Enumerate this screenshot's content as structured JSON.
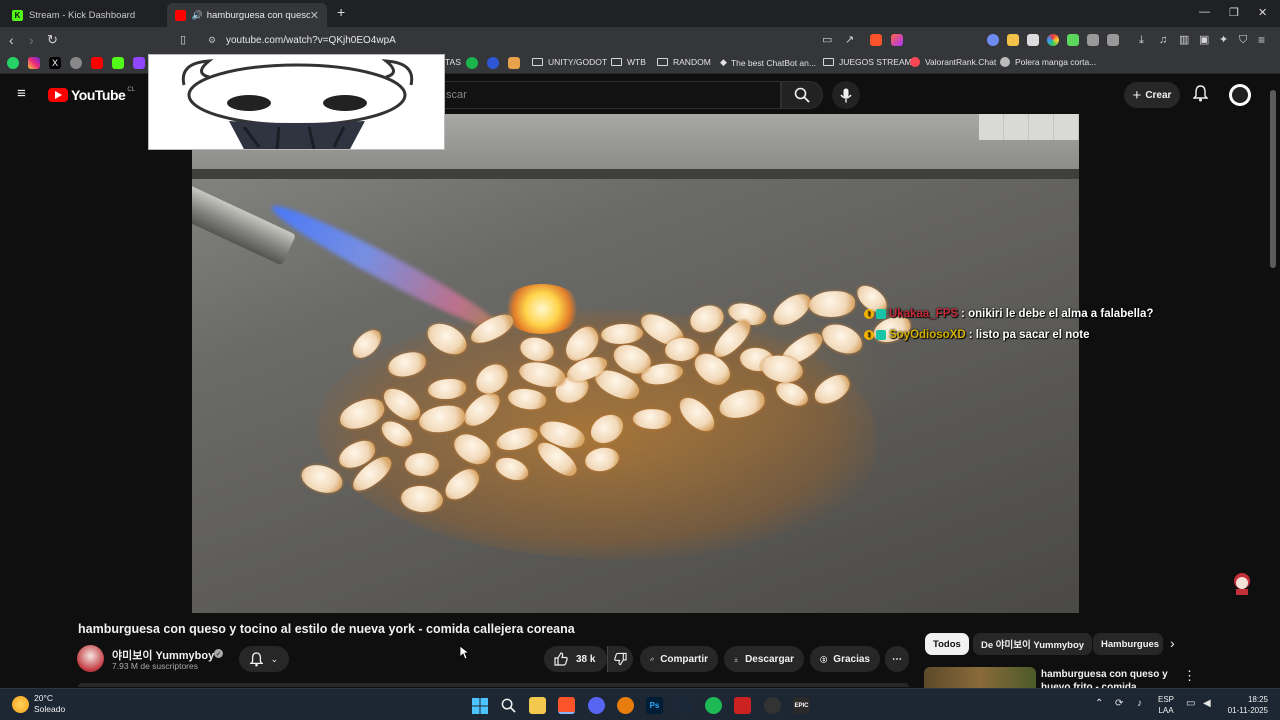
{
  "browser": {
    "tabs": [
      {
        "title": "Stream - Kick Dashboard",
        "active": false
      },
      {
        "title": "hamburguesa con queso y tc",
        "active": true
      }
    ],
    "new_tab": "+",
    "url": "youtube.com/watch?v=QKjh0EO4wpA",
    "window_controls": {
      "minimize": "—",
      "maximize": "❐",
      "close": "✕"
    }
  },
  "bookmarks": {
    "items": [
      {
        "label": "TAS",
        "icon": "bookmark-icon"
      },
      {
        "label": "UNITY/GODOT",
        "icon": "folder-icon"
      },
      {
        "label": "WTB",
        "icon": "folder-icon"
      },
      {
        "label": "RANDOM",
        "icon": "folder-icon"
      },
      {
        "label": "The best ChatBot an...",
        "icon": "diamond-icon"
      },
      {
        "label": "JUEGOS STREAM",
        "icon": "folder-icon"
      },
      {
        "label": "ValorantRank.Chat",
        "icon": "bookmark-icon"
      },
      {
        "label": "Polera manga corta...",
        "icon": "bookmark-icon"
      }
    ]
  },
  "youtube": {
    "logo_text": "YouTube",
    "country_code": "CL",
    "search_placeholder": "scar",
    "create_label": "Crear",
    "video": {
      "title": "hamburguesa con queso y tocino al estilo de nueva york - comida callejera coreana"
    },
    "chat_overlay": [
      {
        "user": "Ukakaa_FPS",
        "message": ": onikiri le debe el alma a falabella?"
      },
      {
        "user": "SoyOdiosoXD",
        "message": ": listo pa sacar el note"
      }
    ],
    "channel": {
      "name": "야미보이 Yummyboy",
      "subscribers": "7.93 M de suscriptores"
    },
    "actions": {
      "likes": "38 k",
      "share": "Compartir",
      "download": "Descargar",
      "thanks": "Gracias",
      "more": "⋯"
    },
    "chips": [
      {
        "label": "Todos",
        "active": true
      },
      {
        "label": "De 야미보이 Yummyboy",
        "active": false
      },
      {
        "label": "Hamburgues",
        "active": false
      }
    ],
    "recommendation": {
      "title": "hamburguesa con queso y huevo frito - comida callejera"
    }
  },
  "taskbar": {
    "weather": {
      "temp": "20°C",
      "condition": "Soleado"
    },
    "language": {
      "line1": "ESP",
      "line2": "LAA"
    },
    "clock": {
      "time": "18:25",
      "date": "01-11-2025"
    }
  },
  "colors": {
    "background": "#0f0f0f",
    "youtube_red": "#ff0000",
    "chip_active": "#f1f1f1",
    "chat_user1": "#c42a3a",
    "chat_user2": "#d6b300"
  }
}
